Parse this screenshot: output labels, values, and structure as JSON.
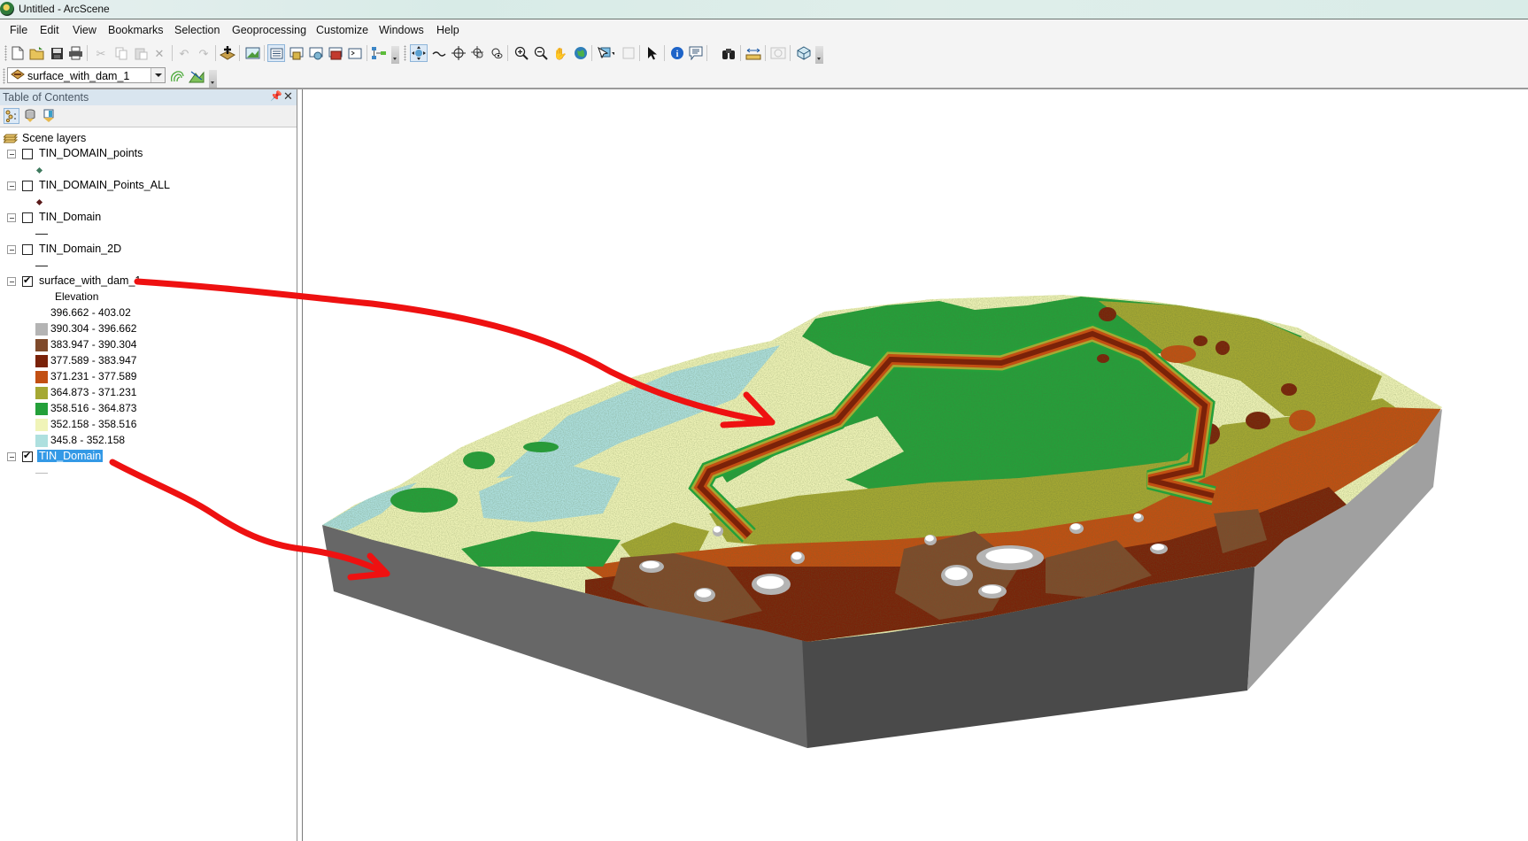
{
  "window": {
    "title": "Untitled - ArcScene"
  },
  "menu": {
    "items": [
      "File",
      "Edit",
      "View",
      "Bookmarks",
      "Selection",
      "Geoprocessing",
      "Customize",
      "Windows",
      "Help"
    ]
  },
  "toolbar": {
    "standard_icons": [
      "new-document-icon",
      "open-folder-icon",
      "save-icon",
      "print-icon",
      "cut-icon",
      "copy-icon",
      "paste-icon",
      "delete-icon",
      "undo-icon",
      "redo-icon",
      "add-data-icon",
      "scene-properties-icon",
      "table-of-contents-icon",
      "catalog-icon",
      "search-window-icon",
      "arctoolbox-icon",
      "python-window-icon",
      "modelbuilder-icon"
    ],
    "tools_icons": [
      "navigate-icon",
      "fly-icon",
      "target-center-icon",
      "zoom-to-target-icon",
      "set-observer-icon",
      "zoom-in-icon",
      "zoom-out-icon",
      "pan-icon",
      "full-extent-icon",
      "select-features-icon",
      "clear-selection-icon",
      "select-elements-icon",
      "identify-icon",
      "html-popup-icon",
      "find-icon",
      "measure-icon",
      "time-slider-icon",
      "3d-effects-icon"
    ],
    "layer_selector": {
      "value": "surface_with_dam_1"
    }
  },
  "toc": {
    "title": "Table of Contents",
    "root_label": "Scene layers",
    "layers": [
      {
        "name": "TIN_DOMAIN_points",
        "checked": false,
        "symbol": "point",
        "symbol_color": "#3f7a5e"
      },
      {
        "name": "TIN_DOMAIN_Points_ALL",
        "checked": false,
        "symbol": "point",
        "symbol_color": "#5a1a1a"
      },
      {
        "name": "TIN_Domain",
        "checked": false,
        "symbol": "line",
        "symbol_color": "#222222"
      },
      {
        "name": "TIN_Domain_2D",
        "checked": false,
        "symbol": "line",
        "symbol_color": "#222222"
      },
      {
        "name": "surface_with_dam_1",
        "checked": true,
        "symbol": "legend"
      },
      {
        "name": "TIN_Domain",
        "checked": true,
        "symbol": "line",
        "symbol_color": "#bbbbbb",
        "selected": true
      }
    ],
    "legend": {
      "field_label": "Elevation",
      "classes": [
        {
          "label": "396.662 - 403.02",
          "color": "#ffffff"
        },
        {
          "label": "390.304 - 396.662",
          "color": "#b4b4b4"
        },
        {
          "label": "383.947 - 390.304",
          "color": "#7f4a2b"
        },
        {
          "label": "377.589 - 383.947",
          "color": "#7a2209"
        },
        {
          "label": "371.231 - 377.589",
          "color": "#c24f12"
        },
        {
          "label": "364.873 - 371.231",
          "color": "#a5a833"
        },
        {
          "label": "358.516 - 364.873",
          "color": "#24a03a"
        },
        {
          "label": "352.158 - 358.516",
          "color": "#f0f4b8"
        },
        {
          "label": "345.8 - 352.158",
          "color": "#aee0df"
        }
      ]
    }
  },
  "scene": {
    "side_wall_light": "#a0a0a0",
    "side_wall_mid": "#676767",
    "side_wall_dark": "#4a4a4a",
    "annotation_color": "#ee1111"
  }
}
